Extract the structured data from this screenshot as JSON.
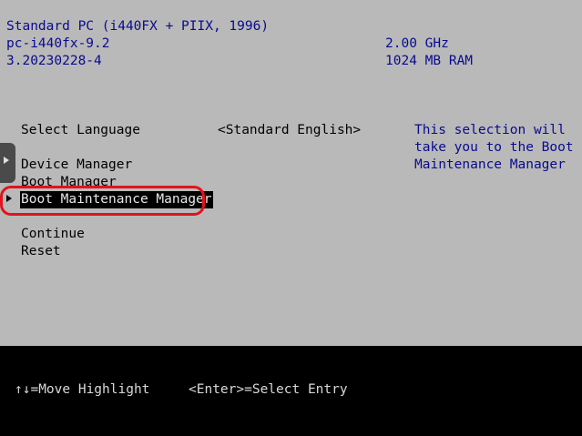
{
  "system": {
    "model": "Standard PC (i440FX + PIIX, 1996)",
    "machine": "pc-i440fx-9.2",
    "firmware_version": "3.20230228-4",
    "cpu_speed": "2.00 GHz",
    "memory": "1024 MB RAM"
  },
  "menu": {
    "language_label": "Select Language",
    "language_value": "<Standard English>",
    "device_manager": "Device Manager",
    "boot_manager": "Boot Manager",
    "boot_maintenance_manager": "Boot Maintenance Manager",
    "continue": "Continue",
    "reset": "Reset"
  },
  "help": {
    "line1": "This selection will",
    "line2": "take you to the Boot",
    "line3": "Maintenance Manager"
  },
  "footer": {
    "move_hint": "↑↓=Move Highlight",
    "enter_hint": "<Enter>=Select Entry"
  },
  "colors": {
    "background": "#b9b9b9",
    "header_text": "#0a0a8f",
    "footer_bg": "#000000",
    "annotation": "#e0141c"
  }
}
